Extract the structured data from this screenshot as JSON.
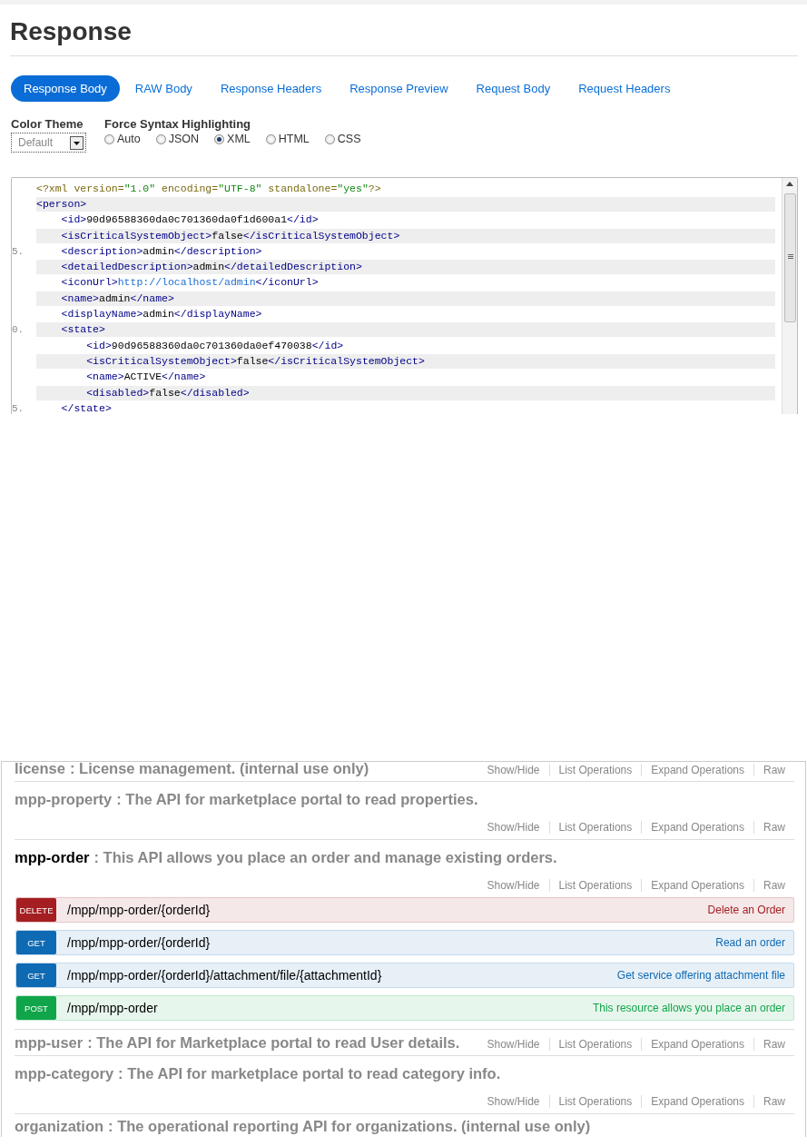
{
  "response": {
    "title": "Response",
    "tabs": [
      {
        "label": "Response Body",
        "selected": true
      },
      {
        "label": "RAW Body",
        "selected": false
      },
      {
        "label": "Response Headers",
        "selected": false
      },
      {
        "label": "Response Preview",
        "selected": false
      },
      {
        "label": "Request Body",
        "selected": false
      },
      {
        "label": "Request Headers",
        "selected": false
      }
    ],
    "color_theme": {
      "label": "Color Theme",
      "value": "Default"
    },
    "syntax": {
      "label": "Force Syntax Highlighting",
      "options": [
        {
          "label": "Auto",
          "selected": false
        },
        {
          "label": "JSON",
          "selected": false
        },
        {
          "label": "XML",
          "selected": true
        },
        {
          "label": "HTML",
          "selected": false
        },
        {
          "label": "CSS",
          "selected": false
        }
      ]
    },
    "code_lines": [
      {
        "tokens": [
          {
            "kind": "pi",
            "text": "<?xml version="
          },
          {
            "kind": "val",
            "text": "\"1.0\""
          },
          {
            "kind": "pi",
            "text": " encoding="
          },
          {
            "kind": "val",
            "text": "\"UTF-8\""
          },
          {
            "kind": "pi",
            "text": " standalone="
          },
          {
            "kind": "val",
            "text": "\"yes\""
          },
          {
            "kind": "pi",
            "text": "?>"
          }
        ]
      },
      {
        "tokens": [
          {
            "kind": "tag",
            "text": "<person>"
          }
        ]
      },
      {
        "tokens": [
          {
            "kind": "tag",
            "text": "    <id>"
          },
          {
            "kind": "text",
            "text": "90d96588360da0c701360da0f1d600a1"
          },
          {
            "kind": "tag",
            "text": "</id>"
          }
        ]
      },
      {
        "tokens": [
          {
            "kind": "tag",
            "text": "    <isCriticalSystemObject>"
          },
          {
            "kind": "text",
            "text": "false"
          },
          {
            "kind": "tag",
            "text": "</isCriticalSystemObject>"
          }
        ]
      },
      {
        "number": "5.",
        "tokens": [
          {
            "kind": "tag",
            "text": "    <description>"
          },
          {
            "kind": "text",
            "text": "admin"
          },
          {
            "kind": "tag",
            "text": "</description>"
          }
        ]
      },
      {
        "tokens": [
          {
            "kind": "tag",
            "text": "    <detailedDescription>"
          },
          {
            "kind": "text",
            "text": "admin"
          },
          {
            "kind": "tag",
            "text": "</detailedDescription>"
          }
        ]
      },
      {
        "tokens": [
          {
            "kind": "tag",
            "text": "    <iconUrl>"
          },
          {
            "kind": "link",
            "text": "http://localhost/admin"
          },
          {
            "kind": "tag",
            "text": "</iconUrl>"
          }
        ]
      },
      {
        "tokens": [
          {
            "kind": "tag",
            "text": "    <name>"
          },
          {
            "kind": "text",
            "text": "admin"
          },
          {
            "kind": "tag",
            "text": "</name>"
          }
        ]
      },
      {
        "tokens": [
          {
            "kind": "tag",
            "text": "    <displayName>"
          },
          {
            "kind": "text",
            "text": "admin"
          },
          {
            "kind": "tag",
            "text": "</displayName>"
          }
        ]
      },
      {
        "number": "0.",
        "tokens": [
          {
            "kind": "tag",
            "text": "    <state>"
          }
        ]
      },
      {
        "tokens": [
          {
            "kind": "tag",
            "text": "        <id>"
          },
          {
            "kind": "text",
            "text": "90d96588360da0c701360da0ef470038"
          },
          {
            "kind": "tag",
            "text": "</id>"
          }
        ]
      },
      {
        "tokens": [
          {
            "kind": "tag",
            "text": "        <isCriticalSystemObject>"
          },
          {
            "kind": "text",
            "text": "false"
          },
          {
            "kind": "tag",
            "text": "</isCriticalSystemObject>"
          }
        ]
      },
      {
        "tokens": [
          {
            "kind": "tag",
            "text": "        <name>"
          },
          {
            "kind": "text",
            "text": "ACTIVE"
          },
          {
            "kind": "tag",
            "text": "</name>"
          }
        ]
      },
      {
        "tokens": [
          {
            "kind": "tag",
            "text": "        <disabled>"
          },
          {
            "kind": "text",
            "text": "false"
          },
          {
            "kind": "tag",
            "text": "</disabled>"
          }
        ]
      },
      {
        "number": "5.",
        "tokens": [
          {
            "kind": "tag",
            "text": "    </state>"
          }
        ]
      }
    ]
  },
  "api_sections": [
    {
      "kind": "inline",
      "name": "license",
      "description": ": License management. (internal use only)",
      "active": false,
      "operations": [
        "Show/Hide",
        "List Operations",
        "Expand Operations",
        "Raw"
      ]
    },
    {
      "kind": "stacked",
      "name": "mpp-property",
      "description": ": The API for marketplace portal to read properties.",
      "active": false,
      "operations": [
        "Show/Hide",
        "List Operations",
        "Expand Operations",
        "Raw"
      ]
    },
    {
      "kind": "stacked",
      "name": "mpp-order",
      "description": ": This API allows you place an order and manage existing orders.",
      "active": true,
      "operations": [
        "Show/Hide",
        "List Operations",
        "Expand Operations",
        "Raw"
      ],
      "endpoints": [
        {
          "kind": "delete",
          "method": "DELETE",
          "path": "/mpp/mpp-order/{orderId}",
          "summary": "Delete an Order"
        },
        {
          "kind": "get",
          "method": "GET",
          "path": "/mpp/mpp-order/{orderId}",
          "summary": "Read an order"
        },
        {
          "kind": "get",
          "method": "GET",
          "path": "/mpp/mpp-order/{orderId}/attachment/file/{attachmentId}",
          "summary": "Get service offering attachment file"
        },
        {
          "kind": "post",
          "method": "POST",
          "path": "/mpp/mpp-order",
          "summary": "This resource allows you place an order"
        }
      ]
    },
    {
      "kind": "inline",
      "name": "mpp-user",
      "description": ": The API for Marketplace portal to read User details.",
      "active": false,
      "operations": [
        "Show/Hide",
        "List Operations",
        "Expand Operations",
        "Raw"
      ]
    },
    {
      "kind": "stacked",
      "name": "mpp-category",
      "description": ": The API for marketplace portal to read category info.",
      "active": false,
      "operations": [
        "Show/Hide",
        "List Operations",
        "Expand Operations",
        "Raw"
      ]
    },
    {
      "kind": "heading",
      "name": "organization",
      "description": ": The operational reporting API for organizations. (internal use only)",
      "active": false
    }
  ]
}
